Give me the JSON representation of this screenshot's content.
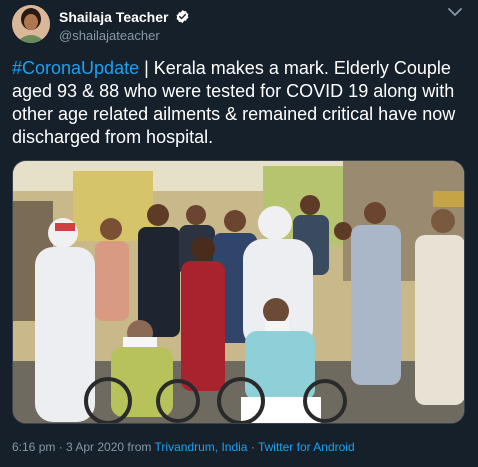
{
  "author": {
    "display_name": "Shailaja Teacher",
    "handle": "@shailajateacher",
    "verified": true
  },
  "tweet": {
    "hashtag": "#CoronaUpdate",
    "body": " | Kerala makes a mark. Elderly Couple aged 93 & 88 who were tested for COVID 19 along with other age related ailments & remained critical have now discharged from hospital."
  },
  "footer": {
    "time": "6:16 pm",
    "sep1": " · ",
    "date": "3 Apr 2020",
    "from": " from ",
    "location": "Trivandrum, India",
    "sep2": " · ",
    "source": "Twitter for Android"
  },
  "colors": {
    "background": "#15202b",
    "accent": "#1da1f2",
    "muted": "#8899a6"
  },
  "icons": [
    "verified-badge-icon",
    "more-chevron-icon"
  ]
}
